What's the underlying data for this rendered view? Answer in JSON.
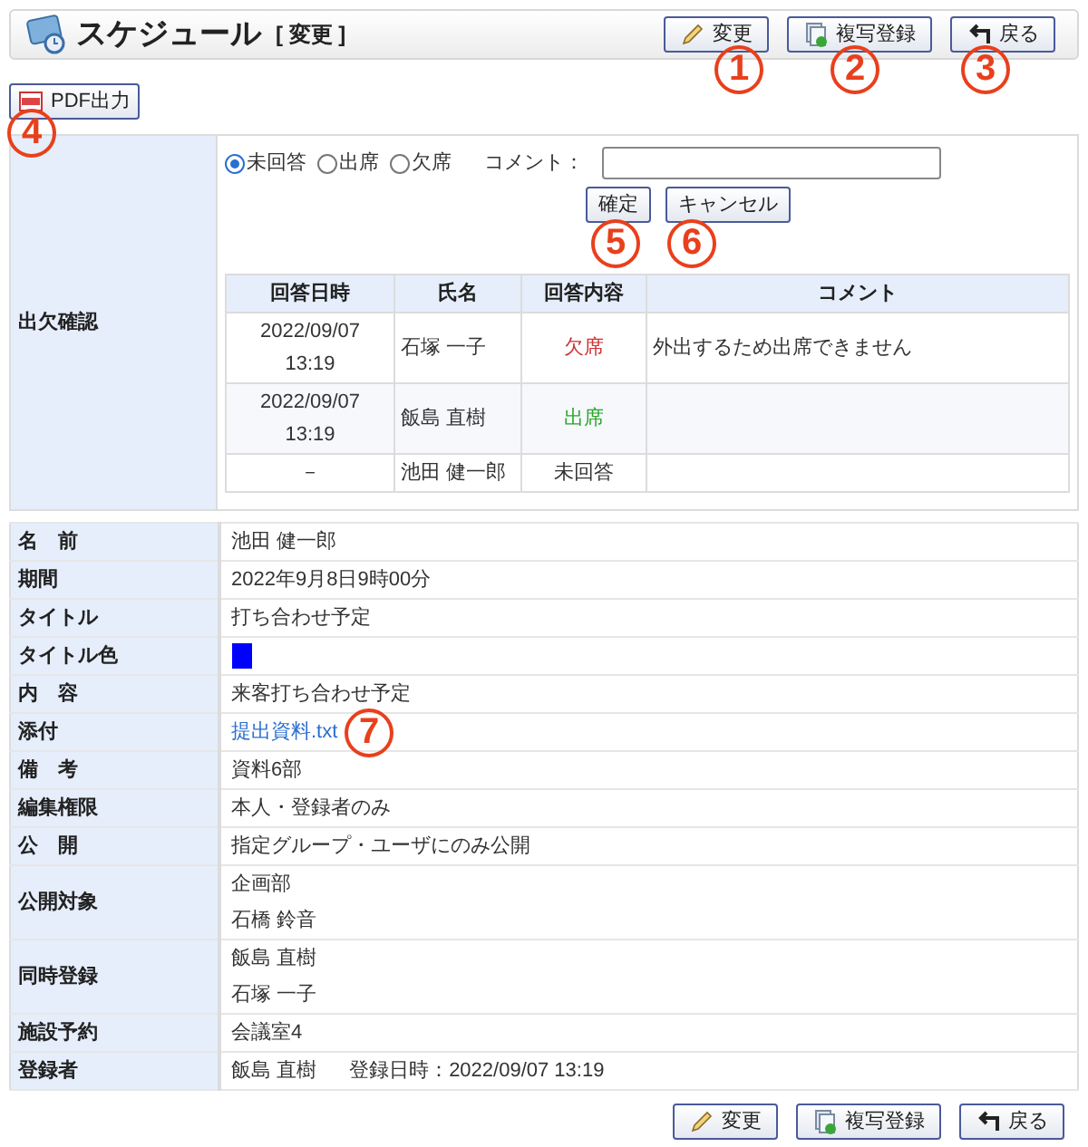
{
  "header": {
    "title": "スケジュール",
    "mode": "[ 変更 ]",
    "buttons": [
      {
        "kind": "edit",
        "label": "変更"
      },
      {
        "kind": "copy",
        "label": "複写登録"
      },
      {
        "kind": "back",
        "label": "戻る"
      }
    ]
  },
  "pdf_button": {
    "label": "PDF出力"
  },
  "attendance": {
    "label": "出欠確認",
    "options": [
      {
        "label": "未回答",
        "selected": true
      },
      {
        "label": "出席",
        "selected": false
      },
      {
        "label": "欠席",
        "selected": false
      }
    ],
    "comment_label": "コメント：",
    "buttons": [
      "確定",
      "キャンセル"
    ],
    "columns": [
      "回答日時",
      "氏名",
      "回答内容",
      "コメント"
    ],
    "rows": [
      {
        "datetime": [
          "2022/09/07",
          "13:19"
        ],
        "name": "石塚 一子",
        "response": "欠席",
        "color": "#d03030",
        "comment": "外出するため出席できません"
      },
      {
        "datetime": [
          "2022/09/07",
          "13:19"
        ],
        "name": "飯島 直樹",
        "response": "出席",
        "color": "#2aa52a",
        "comment": ""
      },
      {
        "datetime": [
          "－"
        ],
        "name": "池田 健一郎",
        "response": "未回答",
        "color": "#333333",
        "comment": ""
      }
    ]
  },
  "details": [
    {
      "label": "名　前",
      "kind": "text",
      "lines": [
        "池田 健一郎"
      ]
    },
    {
      "label": "期間",
      "kind": "text",
      "lines": [
        "2022年9月8日9時00分"
      ]
    },
    {
      "label": "タイトル",
      "kind": "text",
      "lines": [
        "打ち合わせ予定"
      ]
    },
    {
      "label": "タイトル色",
      "kind": "swatch",
      "color": "#0000ff"
    },
    {
      "label": "内　容",
      "kind": "text",
      "lines": [
        "来客打ち合わせ予定"
      ]
    },
    {
      "label": "添付",
      "kind": "link",
      "lines": [
        "提出資料.txt"
      ]
    },
    {
      "label": "備　考",
      "kind": "text",
      "lines": [
        "資料6部"
      ]
    },
    {
      "label": "編集権限",
      "kind": "text",
      "lines": [
        "本人・登録者のみ"
      ]
    },
    {
      "label": "公　開",
      "kind": "text",
      "lines": [
        "指定グループ・ユーザにのみ公開"
      ]
    },
    {
      "label": "公開対象",
      "kind": "text",
      "lines": [
        "企画部",
        "石橋 鈴音"
      ]
    },
    {
      "label": "同時登録",
      "kind": "text",
      "lines": [
        "飯島 直樹",
        "石塚 一子"
      ]
    },
    {
      "label": "施設予約",
      "kind": "text",
      "lines": [
        "会議室4"
      ]
    },
    {
      "label": "登録者",
      "kind": "registrant",
      "lines": [
        "飯島 直樹",
        "登録日時：2022/09/07 13:19"
      ]
    }
  ],
  "footer_buttons": [
    {
      "kind": "edit",
      "label": "変更"
    },
    {
      "kind": "copy",
      "label": "複写登録"
    },
    {
      "kind": "back",
      "label": "戻る"
    }
  ],
  "annotations": [
    "1",
    "2",
    "3",
    "4",
    "5",
    "6",
    "7"
  ]
}
